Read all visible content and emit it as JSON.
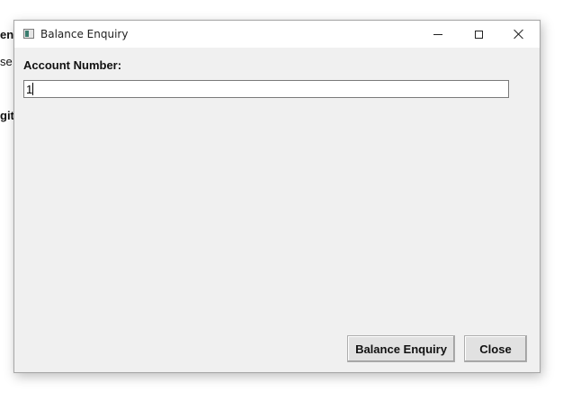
{
  "background_window": {
    "fragments": [
      "en",
      "se",
      "git"
    ]
  },
  "dialog": {
    "title": "Balance Enquiry",
    "icon": "app-window-icon",
    "controls": {
      "minimize": "minimize-icon",
      "maximize": "maximize-icon",
      "close": "close-icon"
    },
    "account_label": "Account Number:",
    "account_value": "1",
    "buttons": {
      "balance_enquiry": "Balance Enquiry",
      "close": "Close"
    }
  }
}
